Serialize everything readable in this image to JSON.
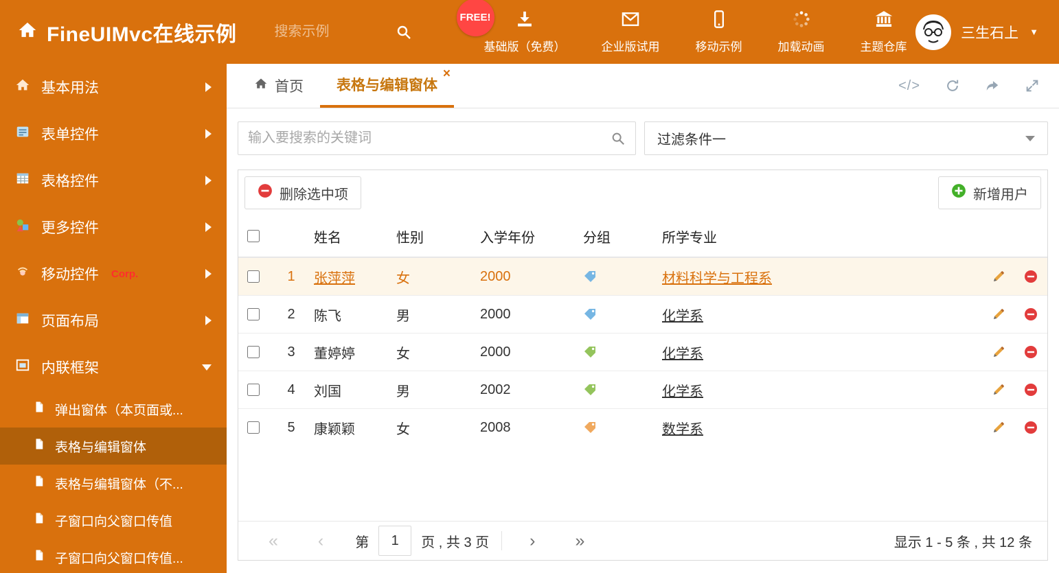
{
  "header": {
    "title": "FineUIMvc在线示例",
    "search_placeholder": "搜索示例",
    "free_badge": "FREE!",
    "nav": [
      {
        "label": "基础版（免费）",
        "icon": "download-icon"
      },
      {
        "label": "企业版试用",
        "icon": "envelope-icon"
      },
      {
        "label": "移动示例",
        "icon": "mobile-icon"
      },
      {
        "label": "加载动画",
        "icon": "spinner-icon"
      },
      {
        "label": "主题仓库",
        "icon": "bank-icon"
      }
    ],
    "username": "三生石上"
  },
  "sidebar": {
    "items": [
      {
        "label": "基本用法"
      },
      {
        "label": "表单控件"
      },
      {
        "label": "表格控件"
      },
      {
        "label": "更多控件"
      },
      {
        "label": "移动控件",
        "badge": "Corp."
      },
      {
        "label": "页面布局"
      },
      {
        "label": "内联框架"
      }
    ],
    "subitems": [
      {
        "label": "弹出窗体（本页面或..."
      },
      {
        "label": "表格与编辑窗体"
      },
      {
        "label": "表格与编辑窗体（不..."
      },
      {
        "label": "子窗口向父窗口传值"
      },
      {
        "label": "子窗口向父窗口传值..."
      }
    ]
  },
  "tabs": {
    "home": "首页",
    "active": "表格与编辑窗体"
  },
  "filters": {
    "search_placeholder": "输入要搜索的关键词",
    "selected_filter": "过滤条件一"
  },
  "grid": {
    "delete_button": "删除选中项",
    "add_button": "新增用户",
    "columns": {
      "name": "姓名",
      "gender": "性别",
      "year": "入学年份",
      "group": "分组",
      "major": "所学专业"
    },
    "rows": [
      {
        "num": "1",
        "name": "张萍萍",
        "gender": "女",
        "year": "2000",
        "tag": "blue",
        "major": "材料科学与工程系",
        "selected": true
      },
      {
        "num": "2",
        "name": "陈飞",
        "gender": "男",
        "year": "2000",
        "tag": "blue",
        "major": "化学系"
      },
      {
        "num": "3",
        "name": "董婷婷",
        "gender": "女",
        "year": "2000",
        "tag": "green",
        "major": "化学系"
      },
      {
        "num": "4",
        "name": "刘国",
        "gender": "男",
        "year": "2002",
        "tag": "green",
        "major": "化学系"
      },
      {
        "num": "5",
        "name": "康颖颖",
        "gender": "女",
        "year": "2008",
        "tag": "orange",
        "major": "数学系"
      }
    ],
    "pagination": {
      "prefix": "第",
      "page": "1",
      "suffix": "页 , 共 3 页",
      "summary": "显示 1 - 5 条 , 共 12 条"
    }
  },
  "icons": {
    "code": "</>",
    "close": "×",
    "caret_down": "▼",
    "first": "«",
    "prev": "‹",
    "next": "›",
    "last": "»"
  },
  "colors": {
    "header_bg": "#d9710d",
    "accent": "#d9710d",
    "active_item_bg": "#b0600a",
    "selected_row_bg": "#fdf6e9",
    "free_badge_bg": "#ff4643",
    "delete_red": "#e23c3c",
    "add_green": "#43b029",
    "tags": {
      "blue": "#76b6e3",
      "green": "#94c45c",
      "orange": "#f0a95e"
    }
  }
}
